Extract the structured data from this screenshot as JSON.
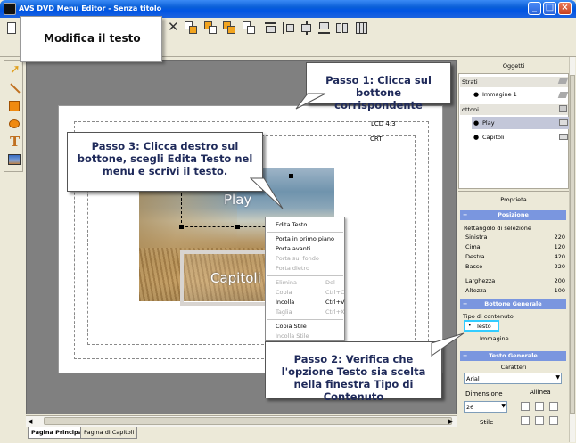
{
  "window": {
    "title": "AVS DVD Menu Editor - Senza titolo"
  },
  "callouts": {
    "edit": "Modifica il testo",
    "step1": "Passo 1: Clicca sul bottone corrispondente",
    "step2": "Passo 2: Verifica che l'opzione Testo sia scelta nella finestra Tipo di Contenuto",
    "step3": "Passo 3: Clicca destro sul bottone, scegli Edita Testo nel menu e scrivi il testo."
  },
  "canvas": {
    "lcd": "LCD 4:3",
    "crt": "CRT",
    "buttons": {
      "play": "Play",
      "chapters": "Capitoli"
    }
  },
  "context_menu": [
    {
      "label": "Edita Testo",
      "shortcut": "",
      "enabled": true
    },
    {
      "label": "Porta in primo piano",
      "shortcut": "",
      "enabled": true
    },
    {
      "label": "Porta avanti",
      "shortcut": "",
      "enabled": true
    },
    {
      "label": "Porta sul fondo",
      "shortcut": "",
      "enabled": false
    },
    {
      "label": "Porta dietro",
      "shortcut": "",
      "enabled": false
    },
    {
      "label": "Elimina",
      "shortcut": "Del",
      "enabled": false
    },
    {
      "label": "Copia",
      "shortcut": "Ctrl+C",
      "enabled": false
    },
    {
      "label": "Incolla",
      "shortcut": "Ctrl+V",
      "enabled": true
    },
    {
      "label": "Taglia",
      "shortcut": "Ctrl+X",
      "enabled": false
    },
    {
      "label": "Copia Stile",
      "shortcut": "",
      "enabled": true
    },
    {
      "label": "Incolla Stile",
      "shortcut": "",
      "enabled": false
    }
  ],
  "tabs": [
    "Pagina Principale",
    "Pagina di Capitoli"
  ],
  "objects": {
    "header": "Oggetti",
    "layers": "Strati",
    "layer_item": "Immagine 1",
    "buttons": "ottoni",
    "button_items": [
      "Play",
      "Capitoli"
    ]
  },
  "properties": {
    "header": "Proprieta",
    "position": {
      "title": "Posizione",
      "group": "Rettangolo di selezione",
      "rows": [
        {
          "label": "Sinistra",
          "value": "220"
        },
        {
          "label": "Cima",
          "value": "120"
        },
        {
          "label": "Destra",
          "value": "420"
        },
        {
          "label": "Basso",
          "value": "220"
        }
      ],
      "rows2": [
        {
          "label": "Larghezza",
          "value": "200"
        },
        {
          "label": "Altezza",
          "value": "100"
        }
      ]
    },
    "general_button": {
      "title": "Bottone Generale",
      "content_type": "Tipo di contenuto",
      "opt_text": "Testo",
      "opt_image": "Immagine"
    },
    "general_text": {
      "title": "Testo Generale",
      "chars_label": "Caratteri",
      "font": "Arial",
      "size_label": "Dimensione",
      "size": "26",
      "align_label": "Allinea",
      "style_label": "Stile"
    }
  },
  "colors": {
    "accent": "#7a96df",
    "selected_row": "#c3c7d9",
    "highlight": "#33ccff"
  }
}
